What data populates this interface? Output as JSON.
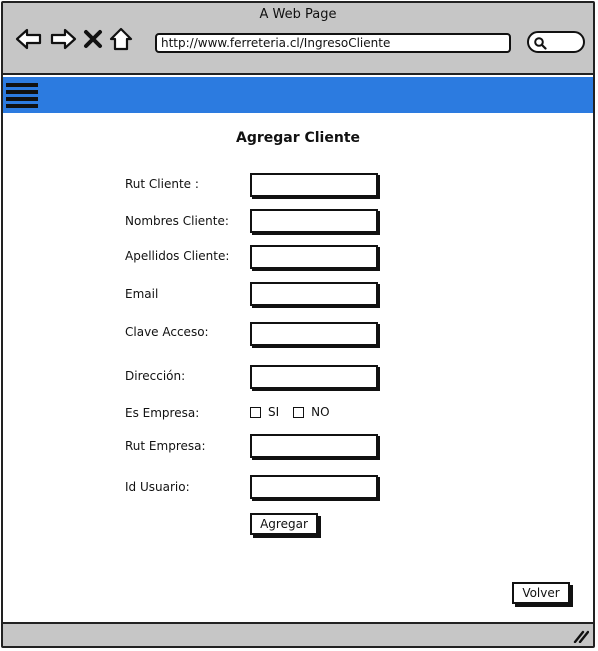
{
  "window": {
    "title": "A Web Page"
  },
  "browser": {
    "url": "http://www.ferreteria.cl/IngresoCliente",
    "icons": [
      "back-arrow-icon",
      "forward-arrow-icon",
      "close-x-icon",
      "home-icon",
      "search-icon"
    ]
  },
  "navbar": {
    "color": "#2c7be0",
    "menu_icon": "hamburger-menu-icon"
  },
  "form": {
    "title": "Agregar Cliente",
    "fields": {
      "rut_cliente": {
        "label": "Rut Cliente :"
      },
      "nombres_cliente": {
        "label": "Nombres Cliente:"
      },
      "apellidos_cliente": {
        "label": "Apellidos Cliente:"
      },
      "email": {
        "label": "Email"
      },
      "clave_acceso": {
        "label": "Clave Acceso:"
      },
      "direccion": {
        "label": "Dirección:"
      },
      "es_empresa": {
        "label": "Es Empresa:",
        "option_si": "SI",
        "option_no": "NO"
      },
      "rut_empresa": {
        "label": "Rut Empresa:"
      },
      "id_usuario": {
        "label": "Id Usuario:"
      }
    },
    "submit_label": "Agregar",
    "back_label": "Volver"
  }
}
